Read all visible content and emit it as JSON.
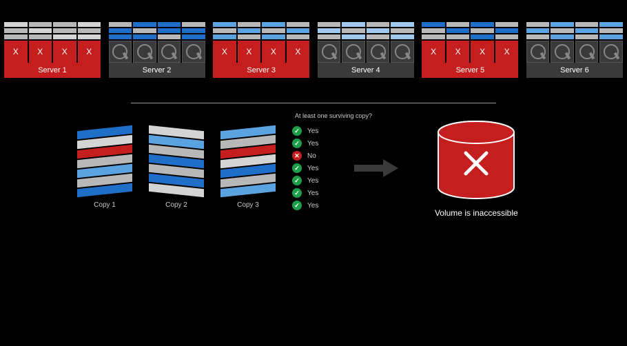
{
  "servers": [
    {
      "name": "Server 1",
      "failed": true,
      "layer_colors": [
        [
          "c-gray2",
          "c-gray",
          "c-gray",
          "c-gray2"
        ],
        [
          "c-gray",
          "c-gray2",
          "c-gray",
          "c-gray"
        ],
        [
          "c-gray",
          "c-gray",
          "c-gray2",
          "c-gray2"
        ]
      ]
    },
    {
      "name": "Server 2",
      "failed": false,
      "layer_colors": [
        [
          "c-gray",
          "c-blue",
          "c-blue",
          "c-gray"
        ],
        [
          "c-blue",
          "c-gray",
          "c-blue",
          "c-blue"
        ],
        [
          "c-blue",
          "c-blue",
          "c-gray",
          "c-blue"
        ]
      ]
    },
    {
      "name": "Server 3",
      "failed": true,
      "layer_colors": [
        [
          "c-blue2",
          "c-gray",
          "c-blue2",
          "c-gray"
        ],
        [
          "c-gray",
          "c-blue2",
          "c-gray",
          "c-blue2"
        ],
        [
          "c-blue2",
          "c-gray",
          "c-blue2",
          "c-gray"
        ]
      ]
    },
    {
      "name": "Server 4",
      "failed": false,
      "layer_colors": [
        [
          "c-gray",
          "c-blue3",
          "c-gray",
          "c-blue3"
        ],
        [
          "c-blue3",
          "c-gray",
          "c-blue3",
          "c-gray"
        ],
        [
          "c-gray",
          "c-blue3",
          "c-gray",
          "c-blue3"
        ]
      ]
    },
    {
      "name": "Server 5",
      "failed": true,
      "layer_colors": [
        [
          "c-blue",
          "c-gray",
          "c-blue",
          "c-gray"
        ],
        [
          "c-gray",
          "c-blue",
          "c-gray",
          "c-blue"
        ],
        [
          "c-gray",
          "c-gray",
          "c-blue",
          "c-gray"
        ]
      ]
    },
    {
      "name": "Server 6",
      "failed": false,
      "layer_colors": [
        [
          "c-gray",
          "c-blue2",
          "c-gray",
          "c-blue2"
        ],
        [
          "c-blue2",
          "c-gray",
          "c-blue2",
          "c-gray"
        ],
        [
          "c-gray",
          "c-blue2",
          "c-gray",
          "c-blue2"
        ]
      ]
    }
  ],
  "drive_fail_mark": "X",
  "copies": [
    {
      "label": "Copy 1",
      "slabs": [
        "c-blue",
        "c-gray2",
        "c-red",
        "c-gray",
        "c-blue2",
        "c-gray",
        "c-blue"
      ]
    },
    {
      "label": "Copy 2",
      "slabs": [
        "c-gray2",
        "c-blue2",
        "c-gray",
        "c-blue",
        "c-gray",
        "c-blue",
        "c-gray2"
      ]
    },
    {
      "label": "Copy 3",
      "slabs": [
        "c-blue2",
        "c-gray",
        "c-red",
        "c-gray2",
        "c-blue",
        "c-gray",
        "c-blue2"
      ]
    }
  ],
  "check_title": "At least one surviving copy?",
  "checks": [
    {
      "ok": true,
      "label": "Yes"
    },
    {
      "ok": true,
      "label": "Yes"
    },
    {
      "ok": false,
      "label": "No"
    },
    {
      "ok": true,
      "label": "Yes"
    },
    {
      "ok": true,
      "label": "Yes"
    },
    {
      "ok": true,
      "label": "Yes"
    },
    {
      "ok": true,
      "label": "Yes"
    }
  ],
  "volume_label": "Volume is inaccessible",
  "colors": {
    "fail": "#c41e1e",
    "ok": "#1d9e4b",
    "arrow": "#3a3a3a"
  }
}
